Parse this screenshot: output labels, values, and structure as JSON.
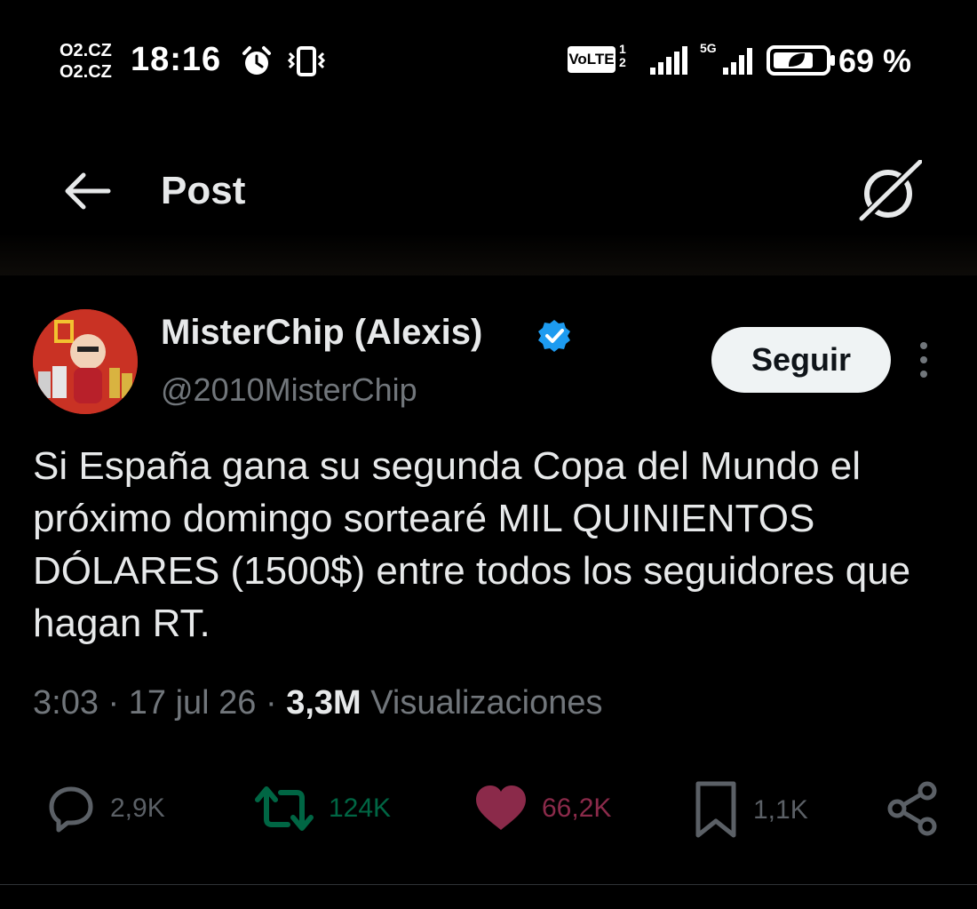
{
  "status_bar": {
    "carrier_1": "O2.CZ",
    "carrier_2": "O2.CZ",
    "time": "18:16",
    "volte": "VoLTE",
    "sim_1": "1",
    "sim_2": "2",
    "network": "5G",
    "battery": "69 %"
  },
  "header": {
    "title": "Post",
    "back_icon": "arrow-left-icon",
    "grok_icon": "grok-icon"
  },
  "tweet": {
    "display_name": "MisterChip (Alexis)",
    "handle": "@2010MisterChip",
    "follow_label": "Seguir",
    "text": "Si España gana su segunda Copa del Mundo el próximo domingo sortearé MIL QUINIENTOS DÓLARES (1500$) entre todos los seguidores que hagan RT.",
    "time": "3:03",
    "date": "17 jul 26",
    "views_count": "3,3M",
    "views_label": "Visualizaciones",
    "separator": "·"
  },
  "actions": {
    "replies": "2,9K",
    "retweets": "124K",
    "likes": "66,2K",
    "bookmarks": "1,1K"
  },
  "colors": {
    "background": "#000000",
    "text": "#e7e9ea",
    "secondary": "#71767b",
    "verified": "#1d9bf0",
    "retweet": "#00ba7c",
    "like": "#f91880"
  }
}
